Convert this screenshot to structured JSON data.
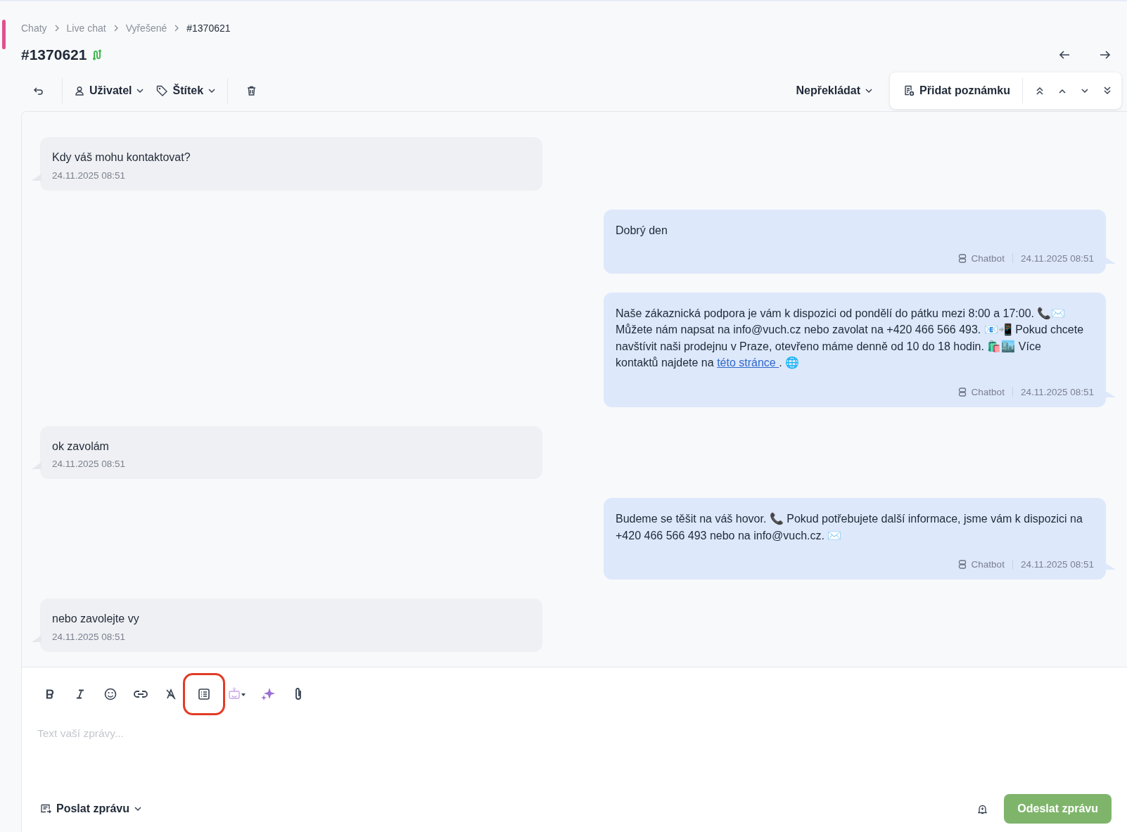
{
  "breadcrumb": [
    "Chaty",
    "Live chat",
    "Vyřešené",
    "#1370621"
  ],
  "title": "#1370621",
  "toolbar": {
    "user": "Uživatel",
    "tag": "Štítek",
    "translate": "Nepřekládat",
    "note": "Přidat poznámku"
  },
  "messages": [
    {
      "kind": "incoming",
      "text": "Kdy váš mohu kontaktovat?",
      "time": "24.11.2025 08:51"
    },
    {
      "kind": "outgoing",
      "text": "Dobrý den",
      "sender": "Chatbot",
      "time": "24.11.2025 08:51"
    },
    {
      "kind": "outgoing",
      "text": "Naše zákaznická podpora je vám k dispozici od pondělí do pátku mezi 8:00 a 17:00. 📞✉️ Můžete nám napsat na info@vuch.cz nebo zavolat na +420 466 566 493. 📧📲 Pokud chcete navštívit naši prodejnu v Praze, otevřeno máme denně od 10 do 18 hodin. 🛍️🏙️ Více kontaktů najdete na",
      "link": "této stránce ",
      "after": ". 🌐",
      "sender": "Chatbot",
      "time": "24.11.2025 08:51"
    },
    {
      "kind": "incoming",
      "text": "ok zavolám",
      "time": "24.11.2025 08:51"
    },
    {
      "kind": "outgoing",
      "text": "Budeme se těšit na váš hovor. 📞 Pokud potřebujete další informace, jsme vám k dispozici na +420 466 566 493 nebo na info@vuch.cz. ✉️",
      "sender": "Chatbot",
      "time": "24.11.2025 08:51"
    },
    {
      "kind": "incoming",
      "text": "nebo zavolejte vy",
      "time": "24.11.2025 08:51"
    }
  ],
  "composer": {
    "tools": [
      {
        "kind": "bold",
        "highlighted": false
      },
      {
        "kind": "italic",
        "highlighted": false
      },
      {
        "kind": "emoji",
        "highlighted": false
      },
      {
        "kind": "link",
        "highlighted": false
      },
      {
        "kind": "clear",
        "highlighted": false
      },
      {
        "kind": "list",
        "highlighted": true
      },
      {
        "kind": "bot",
        "highlighted": false
      },
      {
        "kind": "sparkle",
        "highlighted": false
      },
      {
        "kind": "attach",
        "highlighted": false
      }
    ],
    "placeholder": "Text vaší zprávy...",
    "mode": "Poslat zprávu",
    "send": "Odeslat zprávu"
  }
}
